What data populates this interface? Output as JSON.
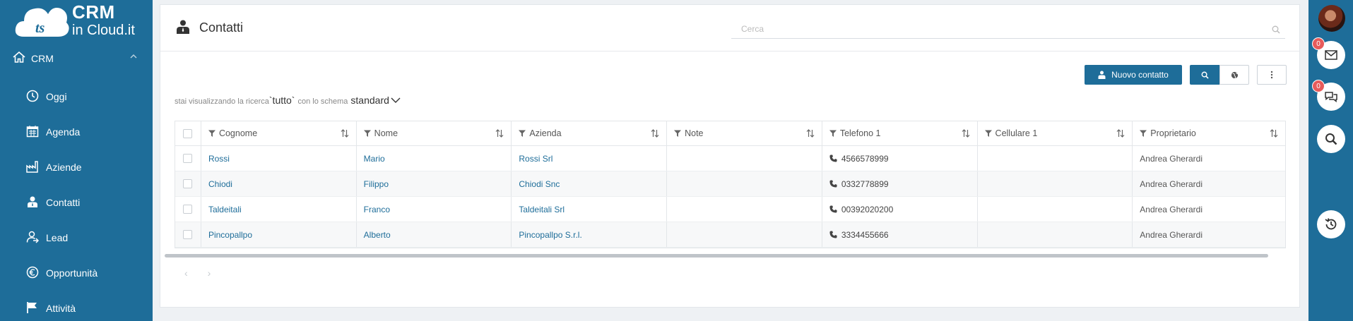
{
  "brand": {
    "line1": "CRM",
    "line2": "in Cloud.it",
    "mark": "ts"
  },
  "sidebar": {
    "section": {
      "label": "CRM",
      "icon": "home-icon"
    },
    "items": [
      {
        "label": "Oggi",
        "icon": "clock-icon"
      },
      {
        "label": "Agenda",
        "icon": "calendar-icon"
      },
      {
        "label": "Aziende",
        "icon": "factory-icon"
      },
      {
        "label": "Contatti",
        "icon": "contact-icon"
      },
      {
        "label": "Lead",
        "icon": "lead-icon"
      },
      {
        "label": "Opportunità",
        "icon": "euro-icon"
      },
      {
        "label": "Attività",
        "icon": "flag-icon"
      }
    ]
  },
  "rail": {
    "mail_count": "0",
    "chat_count": "0"
  },
  "page": {
    "title": "Contatti",
    "search_placeholder": "Cerca",
    "new_contact_label": "Nuovo contatto",
    "viewing_prefix": "stai visualizzando la ricerca",
    "viewing_query": "`tutto`",
    "viewing_middle": "con lo schema",
    "viewing_schema": "standard"
  },
  "table": {
    "columns": [
      "Cognome",
      "Nome",
      "Azienda",
      "Note",
      "Telefono 1",
      "Cellulare 1",
      "Proprietario"
    ],
    "rows": [
      {
        "cognome": "Rossi",
        "nome": "Mario",
        "azienda": "Rossi Srl",
        "note": "",
        "telefono": "4566578999",
        "cellulare": "",
        "proprietario": "Andrea Gherardi"
      },
      {
        "cognome": "Chiodi",
        "nome": "Filippo",
        "azienda": "Chiodi Snc",
        "note": "",
        "telefono": "0332778899",
        "cellulare": "",
        "proprietario": "Andrea Gherardi"
      },
      {
        "cognome": "Taldeitali",
        "nome": "Franco",
        "azienda": "Taldeitali Srl",
        "note": "",
        "telefono": "00392020200",
        "cellulare": "",
        "proprietario": "Andrea Gherardi"
      },
      {
        "cognome": "Pincopallpo",
        "nome": "Alberto",
        "azienda": "Pincopallpo S.r.l.",
        "note": "",
        "telefono": "3334455666",
        "cellulare": "",
        "proprietario": "Andrea Gherardi"
      }
    ]
  },
  "pager": {
    "prev": "‹",
    "next": "›"
  },
  "colors": {
    "brand": "#1e6d99",
    "link": "#1e6d99",
    "badge": "#e85b5b"
  }
}
